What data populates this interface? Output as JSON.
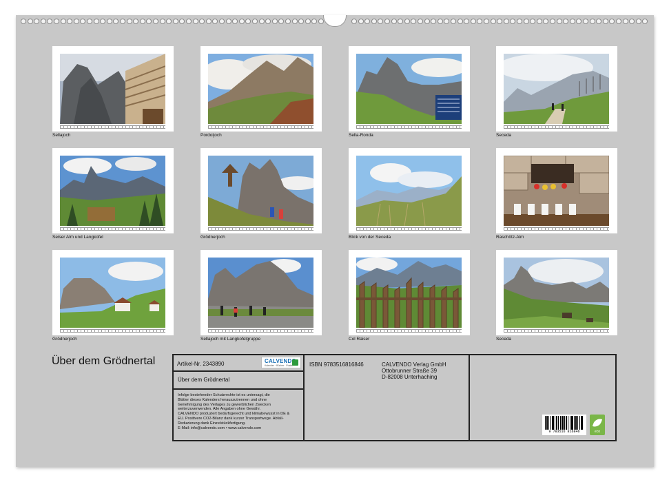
{
  "photos": [
    {
      "caption": "Sellajoch"
    },
    {
      "caption": "Pordoijoch"
    },
    {
      "caption": "Sella-Ronda"
    },
    {
      "caption": "Seceda"
    },
    {
      "caption": "Seiser Alm und Langkofel"
    },
    {
      "caption": "Grödnerjoch"
    },
    {
      "caption": "Blick von der Seceda"
    },
    {
      "caption": "Raschötz-Alm"
    },
    {
      "caption": "Grödnerjoch"
    },
    {
      "caption": "Sellajoch mit Langkofelgruppe"
    },
    {
      "caption": "Col Raiser"
    },
    {
      "caption": "Seceda"
    }
  ],
  "cover_title": "Über dem Grödnertal",
  "info": {
    "article": "Artikel-Nr. 2343890",
    "logo_text": "CALVENDO",
    "logo_sub": "Kalender · Bücher · Poster",
    "title": "Über dem Grödnertal",
    "legal": [
      "Infolge bestehender Schutzrechte ist es untersagt, die",
      "Blätter dieses Kalenders herauszutrennen und ohne",
      "Genehmigung des Verlages zu gewerblichen Zwecken",
      "weiterzuverwenden. Alle Angaben ohne Gewähr.",
      "CALVENDO produziert bedarfsgerecht und klimabewusst in DE &",
      "EU. Positivere CO2-Bilanz dank kurzer Transportwege. Abfall-",
      "Reduzierung dank Einzelstückfertigung.",
      "E-Mail: info@calvendo.com • www.calvendo.com"
    ],
    "isbn": "ISBN 9783516816846",
    "publisher": [
      "CALVENDO Verlag GmbH",
      "Ottobrunner Straße 39",
      "D-82008 Unterhaching"
    ],
    "barcode_number": "9 783516 816846",
    "eco_label": "eco"
  }
}
